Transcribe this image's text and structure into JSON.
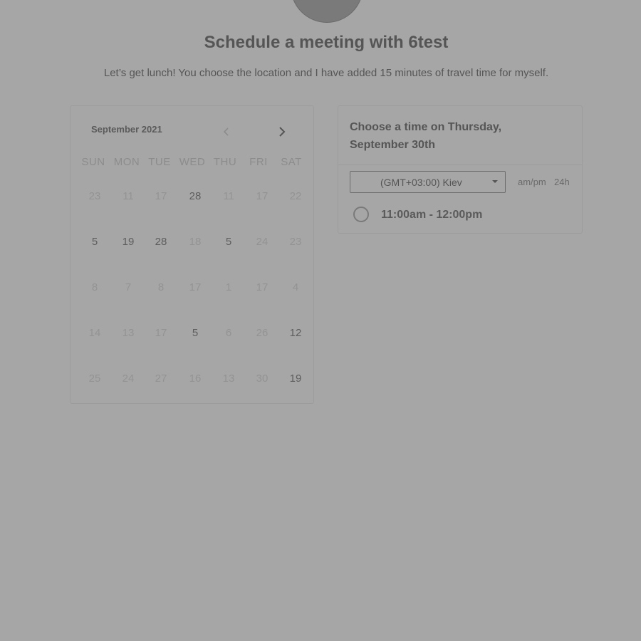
{
  "header": {
    "title": "Schedule a meeting with 6test",
    "subtitle": "Let’s get lunch! You choose the location and I have added 15 minutes of travel time for myself."
  },
  "calendar": {
    "month_label": "September 2021",
    "prev_icon": "chevron-left-icon",
    "next_icon": "chevron-right-icon",
    "weekdays": [
      "SUN",
      "MON",
      "TUE",
      "WED",
      "THU",
      "FRI",
      "SAT"
    ],
    "weeks": [
      [
        {
          "label": "23",
          "available": false
        },
        {
          "label": "11",
          "available": false
        },
        {
          "label": "17",
          "available": false
        },
        {
          "label": "28",
          "available": true
        },
        {
          "label": "11",
          "available": false
        },
        {
          "label": "17",
          "available": false
        },
        {
          "label": "22",
          "available": false
        }
      ],
      [
        {
          "label": "5",
          "available": true
        },
        {
          "label": "19",
          "available": true
        },
        {
          "label": "28",
          "available": true
        },
        {
          "label": "18",
          "available": false
        },
        {
          "label": "5",
          "available": true
        },
        {
          "label": "24",
          "available": false
        },
        {
          "label": "23",
          "available": false
        }
      ],
      [
        {
          "label": "8",
          "available": false
        },
        {
          "label": "7",
          "available": false
        },
        {
          "label": "8",
          "available": false
        },
        {
          "label": "17",
          "available": false
        },
        {
          "label": "1",
          "available": false
        },
        {
          "label": "17",
          "available": false
        },
        {
          "label": "4",
          "available": false
        }
      ],
      [
        {
          "label": "14",
          "available": false
        },
        {
          "label": "13",
          "available": false
        },
        {
          "label": "17",
          "available": false
        },
        {
          "label": "5",
          "available": true
        },
        {
          "label": "6",
          "available": false
        },
        {
          "label": "26",
          "available": false
        },
        {
          "label": "12",
          "available": true
        }
      ],
      [
        {
          "label": "25",
          "available": false
        },
        {
          "label": "24",
          "available": false
        },
        {
          "label": "27",
          "available": false
        },
        {
          "label": "16",
          "available": false
        },
        {
          "label": "13",
          "available": false
        },
        {
          "label": "30",
          "available": false
        },
        {
          "label": "19",
          "available": true
        }
      ]
    ]
  },
  "times": {
    "title": "Choose a time on Thursday, September 30th",
    "timezone": "(GMT+03:00) Kiev",
    "format_ampm": "am/pm",
    "format_24h": "24h",
    "slots": [
      {
        "label": "11:00am - 12:00pm"
      }
    ]
  },
  "colors": {
    "overlay_background": "#a6a6a6",
    "text_primary": "#555555"
  }
}
